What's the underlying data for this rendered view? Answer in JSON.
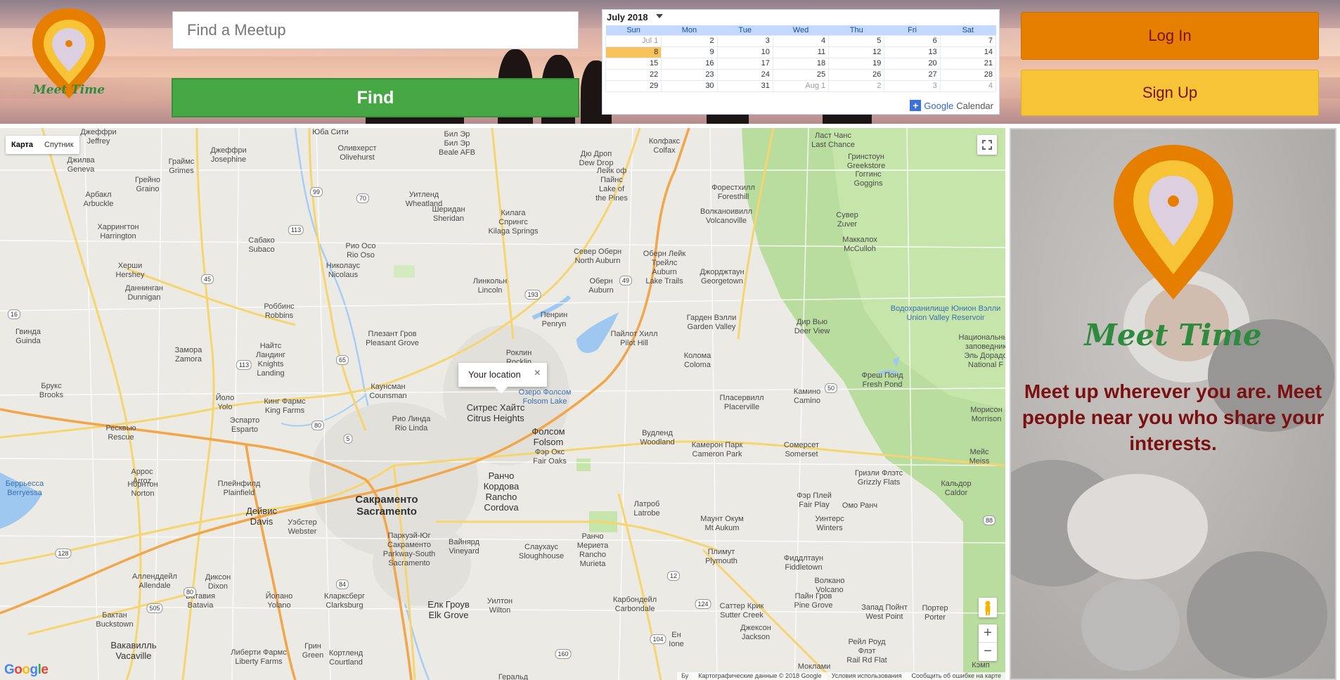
{
  "brand": {
    "name": "Meet Time"
  },
  "search": {
    "placeholder": "Find a Meetup",
    "button_label": "Find"
  },
  "auth": {
    "login_label": "Log In",
    "signup_label": "Sign Up"
  },
  "calendar": {
    "month_label": "July 2018",
    "weekdays": [
      "Sun",
      "Mon",
      "Tue",
      "Wed",
      "Thu",
      "Fri",
      "Sat"
    ],
    "weeks": [
      [
        "Jul 1",
        "2",
        "3",
        "4",
        "5",
        "6",
        "7"
      ],
      [
        "8",
        "9",
        "10",
        "11",
        "12",
        "13",
        "14"
      ],
      [
        "15",
        "16",
        "17",
        "18",
        "19",
        "20",
        "21"
      ],
      [
        "22",
        "23",
        "24",
        "25",
        "26",
        "27",
        "28"
      ],
      [
        "29",
        "30",
        "31",
        "Aug 1",
        "2",
        "3",
        "4"
      ]
    ],
    "today": "8",
    "footer_google": "Google",
    "footer_calendar": "Calendar"
  },
  "map": {
    "type_map": "Карта",
    "type_satellite": "Спутник",
    "info_window_text": "Your location",
    "google_logo": "Google",
    "footer": [
      "Бу",
      "Картографические данные © 2018 Google",
      "Условия использования",
      "Сообщить об ошибке на карте"
    ],
    "labels": [
      {
        "t": "Джеффри\nJeffrey",
        "c": "s"
      },
      {
        "t": "Юба Сити",
        "c": "s"
      },
      {
        "t": "Бил Эр\nБил Эр\nBeale AFB",
        "c": "s"
      },
      {
        "t": "Колфакс\nColfax",
        "c": "s"
      },
      {
        "t": "Ласт Чанс\nLast Chance",
        "c": "s"
      },
      {
        "t": "Джеффри\nJosephine",
        "c": "s"
      },
      {
        "t": "Оливхерст\nOlivehurst",
        "c": "s"
      },
      {
        "t": "Дю Дроп\nDew Drop",
        "c": "s"
      },
      {
        "t": "Гринстоун\nGreekstore",
        "c": "s"
      },
      {
        "t": "Джилва\nGeneva",
        "c": "s"
      },
      {
        "t": "Граймс\nGrimes",
        "c": "s"
      },
      {
        "t": "Лейк оф\nПайнс\nLake of\nthe Pines",
        "c": "s"
      },
      {
        "t": "Форестхилл\nForesthill",
        "c": "s"
      },
      {
        "t": "Гоггинс\nGoggins",
        "c": "s"
      },
      {
        "t": "Арбакл\nArbuckle",
        "c": "s"
      },
      {
        "t": "Грейно\nGraino",
        "c": "s"
      },
      {
        "t": "Уитленд\nWheatland",
        "c": "s"
      },
      {
        "t": "Шеридан\nSheridan",
        "c": "s"
      },
      {
        "t": "Килага\nСпрингс\nKilaga Springs",
        "c": "s"
      },
      {
        "t": "Волканоивилл\nVolcanoville",
        "c": "s"
      },
      {
        "t": "Сувер\nZuver",
        "c": "s"
      },
      {
        "t": "Харрингтон\nHarrington",
        "c": "s"
      },
      {
        "t": "Маккалох\nMcCulloh",
        "c": "s"
      },
      {
        "t": "Сабако\nSubaco",
        "c": "s"
      },
      {
        "t": "Рио Осо\nRio Oso",
        "c": "s"
      },
      {
        "t": "Север Оберн\nNorth Auburn",
        "c": "s"
      },
      {
        "t": "Оберн Лейк\nТрейлс\nAuburn\nLake Trails",
        "c": "s"
      },
      {
        "t": "Джорджтаун\nGeorgetown",
        "c": "s"
      },
      {
        "t": "Херши\nHershey",
        "c": "s"
      },
      {
        "t": "Николаус\nNicolaus",
        "c": "s"
      },
      {
        "t": "Линкольн\nLincoln",
        "c": "s"
      },
      {
        "t": "Оберн\nAuburn",
        "c": "s"
      },
      {
        "t": "Даннинган\nDunnigan",
        "c": "s"
      },
      {
        "t": "Роббинс\nRobbins",
        "c": "s"
      },
      {
        "t": "Пенрин\nPenryn",
        "c": "s"
      },
      {
        "t": "Гарден Вэлли\nGarden Valley",
        "c": "s"
      },
      {
        "t": "Водохранилище Юнион Вэлли\nUnion Valley Reservoir",
        "c": "w"
      },
      {
        "t": "Гвинда\nGuinda",
        "c": "s"
      },
      {
        "t": "Плезант Гров\nPleasant Grove",
        "c": "s"
      },
      {
        "t": "Пайлот Хилл\nPilot Hill",
        "c": "s"
      },
      {
        "t": "Дир Вью\nDeer View",
        "c": "s"
      },
      {
        "t": "Замора\nZamora",
        "c": "s"
      },
      {
        "t": "Найтс\nЛандинг\nKnights\nLanding",
        "c": "s"
      },
      {
        "t": "Роклин\nRocklin",
        "c": "s"
      },
      {
        "t": "Колома\nColoma",
        "c": "s"
      },
      {
        "t": "Национальный\nзаповедник\nЭль Дорадо\nNational F",
        "c": "s"
      },
      {
        "t": "Фреш Понд\nFresh Pond",
        "c": "s"
      },
      {
        "t": "Каунсман\nCounsman",
        "c": "s"
      },
      {
        "t": "Озеро Фолсом\nFolsom Lake",
        "c": "w"
      },
      {
        "t": "Камино\nCamino",
        "c": "s"
      },
      {
        "t": "Брукс\nBrooks",
        "c": "s"
      },
      {
        "t": "Йоло\nYolo",
        "c": "s"
      },
      {
        "t": "Кинг Фармс\nKing Farms",
        "c": "s"
      },
      {
        "t": "Пласервилл\nPlacerville",
        "c": "s"
      },
      {
        "t": "Морисон\nMorrison",
        "c": "s"
      },
      {
        "t": "Ситрес Хайтс\nCitrus Heights",
        "c": "m"
      },
      {
        "t": "Рио Линда\nRio Linda",
        "c": "s"
      },
      {
        "t": "Фолсом\nFolsom",
        "c": "m"
      },
      {
        "t": "Ресквью\nRescue",
        "c": "s"
      },
      {
        "t": "Эспарто\nEsparto",
        "c": "s"
      },
      {
        "t": "Вудленд\nWoodland",
        "c": "s"
      },
      {
        "t": "Камерон Парк\nCameron Park",
        "c": "s"
      },
      {
        "t": "Фэр Окс\nFair Oaks",
        "c": "s"
      },
      {
        "t": "Сомерсет\nSomerset",
        "c": "s"
      },
      {
        "t": "Мейс\nMeiss",
        "c": "s"
      },
      {
        "t": "Гризли Флэтс\nGrizzly Flats",
        "c": "s"
      },
      {
        "t": "Аррос\nArroz",
        "c": "s"
      },
      {
        "t": "Ранчо\nКордова\nRancho\nCordova",
        "c": "m"
      },
      {
        "t": "Кальдор\nCaldor",
        "c": "s"
      },
      {
        "t": "Беррьесса\nBerryessa",
        "c": "w"
      },
      {
        "t": "Норнтон\nNorton",
        "c": "s"
      },
      {
        "t": "Плейнфилд\nPlainfield",
        "c": "s"
      },
      {
        "t": "Сакраменто\nSacramento",
        "c": "b"
      },
      {
        "t": "Фэр Плей\nFair Play",
        "c": "s"
      },
      {
        "t": "Омо Ранч",
        "c": "s"
      },
      {
        "t": "Дейвис\nDavis",
        "c": "m"
      },
      {
        "t": "Уэбстер\nWebster",
        "c": "s"
      },
      {
        "t": "Латроб\nLatrobe",
        "c": "s"
      },
      {
        "t": "Маунт Окум\nMt Aukum",
        "c": "s"
      },
      {
        "t": "Уинтерс\nWinters",
        "c": "s"
      },
      {
        "t": "Паркуэй-Юг\nСакраменто\nParkway-South\nSacramento",
        "c": "s"
      },
      {
        "t": "Ранчо\nМериета\nRancho\nMurieta",
        "c": "s"
      },
      {
        "t": "Фиддлтаун\nFiddletown",
        "c": "s"
      },
      {
        "t": "Слаухаус\nSloughhouse",
        "c": "s"
      },
      {
        "t": "Вайнярд\nVineyard",
        "c": "s"
      },
      {
        "t": "Плимут\nPlymouth",
        "c": "s"
      },
      {
        "t": "Алленддейл\nAllendale",
        "c": "s"
      },
      {
        "t": "Диксон\nDixon",
        "c": "s"
      },
      {
        "t": "Волкано\nVolcano",
        "c": "s"
      },
      {
        "t": "Батавия\nBatavia",
        "c": "s"
      },
      {
        "t": "Йолано\nYolano",
        "c": "s"
      },
      {
        "t": "Кларксберг\nClarksburg",
        "c": "s"
      },
      {
        "t": "Пайн Гров\nPine Grove",
        "c": "s"
      },
      {
        "t": "Запад Пойнт\nWest Point",
        "c": "s"
      },
      {
        "t": "Портер\nPorter",
        "c": "s"
      },
      {
        "t": "Бактан\nBuckstown",
        "c": "s"
      },
      {
        "t": "Елк Гроув\nElk Grove",
        "c": "m"
      },
      {
        "t": "Уилтон\nWilton",
        "c": "s"
      },
      {
        "t": "Карбондейл\nCarbondale",
        "c": "s"
      },
      {
        "t": "Саттер Крик\nSutter Creek",
        "c": "s"
      },
      {
        "t": "Вакавилль\nVacaville",
        "c": "m"
      },
      {
        "t": "Джексон\nJackson",
        "c": "s"
      },
      {
        "t": "Ен\nIone",
        "c": "s"
      },
      {
        "t": "Рейл Роуд\nФлэт\nRail Rd Flat",
        "c": "s"
      },
      {
        "t": "Либерти Фармс\nLiberty Farms",
        "c": "s"
      },
      {
        "t": "Грин\nGreen",
        "c": "s"
      },
      {
        "t": "Кортленд\nCourtland",
        "c": "s"
      },
      {
        "t": "Моклами",
        "c": "s"
      },
      {
        "t": "Геральд",
        "c": "s"
      },
      {
        "t": "Кэмп",
        "c": "s"
      }
    ],
    "routes": [
      "99",
      "70",
      "65",
      "113",
      "45",
      "16",
      "113",
      "80",
      "5",
      "50",
      "49",
      "193",
      "88",
      "104",
      "124",
      "84",
      "80",
      "160",
      "12",
      "505",
      "128"
    ]
  },
  "panel": {
    "brand": "Meet Time",
    "tagline": "Meet up wherever you are. Meet people near you who share your interests."
  },
  "colors": {
    "brand_orange": "#e67e00",
    "brand_yellow": "#f6c436",
    "brand_green": "#2e8b3d",
    "find_green": "#45a845",
    "tagline_red": "#7a1010"
  }
}
